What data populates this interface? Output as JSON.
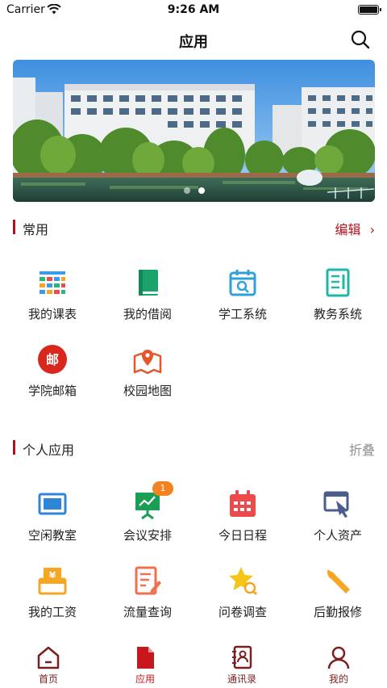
{
  "status_bar": {
    "carrier": "Carrier",
    "time": "9:26 AM"
  },
  "nav": {
    "title": "应用",
    "search_icon": "search-icon"
  },
  "banner": {
    "slides": 2,
    "active_slide": 2
  },
  "sections": {
    "common": {
      "title": "常用",
      "action": "编辑",
      "apps": [
        {
          "label": "我的课表",
          "icon": "timetable-icon"
        },
        {
          "label": "我的借阅",
          "icon": "book-icon"
        },
        {
          "label": "学工系统",
          "icon": "calendar-search-icon"
        },
        {
          "label": "教务系统",
          "icon": "document-icon"
        },
        {
          "label": "学院邮箱",
          "icon": "mail-seal-icon"
        },
        {
          "label": "校园地图",
          "icon": "map-pin-icon"
        }
      ]
    },
    "personal": {
      "title": "个人应用",
      "action": "折叠",
      "apps": [
        {
          "label": "空闲教室",
          "icon": "monitor-icon",
          "badge": ""
        },
        {
          "label": "会议安排",
          "icon": "presentation-icon",
          "badge": "1"
        },
        {
          "label": "今日日程",
          "icon": "schedule-icon",
          "badge": ""
        },
        {
          "label": "个人资产",
          "icon": "asset-icon",
          "badge": ""
        },
        {
          "label": "我的工资",
          "icon": "salary-icon",
          "badge": ""
        },
        {
          "label": "流量查询",
          "icon": "form-edit-icon",
          "badge": ""
        },
        {
          "label": "问卷调查",
          "icon": "star-search-icon",
          "badge": ""
        },
        {
          "label": "后勤报修",
          "icon": "wrench-icon",
          "badge": ""
        }
      ]
    }
  },
  "tabs": [
    {
      "label": "首页",
      "icon": "home-icon",
      "active": false
    },
    {
      "label": "应用",
      "icon": "file-icon",
      "active": true
    },
    {
      "label": "通讯录",
      "icon": "contacts-icon",
      "active": false
    },
    {
      "label": "我的",
      "icon": "user-icon",
      "active": false
    }
  ],
  "colors": {
    "accent": "#b2121b",
    "badge": "#f2831e",
    "tab_text": "#7a1f1f"
  }
}
